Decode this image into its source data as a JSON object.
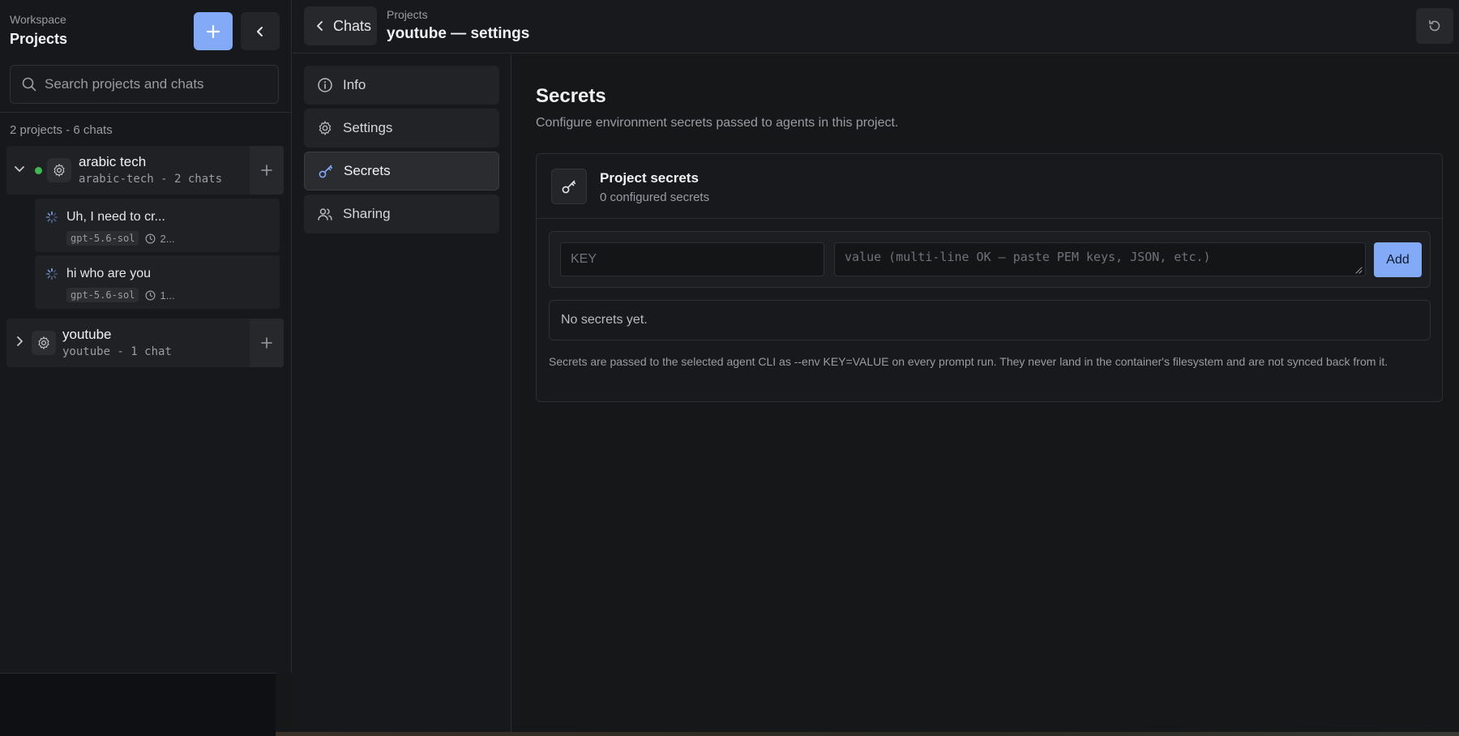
{
  "sidebar": {
    "eyebrow": "Workspace",
    "title": "Projects",
    "search_placeholder": "Search projects and chats",
    "summary": "2 projects - 6 chats",
    "projects": [
      {
        "name": "arabic tech",
        "sub": "arabic-tech - 2 chats",
        "status_color": "#3fb950",
        "chats": [
          {
            "title": "Uh, I need to cr...",
            "model": "gpt-5.6-sol",
            "time": "2..."
          },
          {
            "title": "hi who are you",
            "model": "gpt-5.6-sol",
            "time": "1..."
          }
        ]
      },
      {
        "name": "youtube",
        "sub": "youtube - 1 chat"
      }
    ]
  },
  "topbar": {
    "back_label": "Chats",
    "breadcrumb": "Projects",
    "title": "youtube — settings"
  },
  "nav": {
    "items": [
      {
        "label": "Info",
        "icon": "info-icon"
      },
      {
        "label": "Settings",
        "icon": "gear-icon"
      },
      {
        "label": "Secrets",
        "icon": "key-icon",
        "active": true
      },
      {
        "label": "Sharing",
        "icon": "users-icon"
      }
    ]
  },
  "main": {
    "heading": "Secrets",
    "description": "Configure environment secrets passed to agents in this project.",
    "card": {
      "title": "Project secrets",
      "subtitle": "0 configured secrets",
      "key_placeholder": "KEY",
      "value_placeholder": "value (multi-line OK — paste PEM keys, JSON, etc.)",
      "add_label": "Add",
      "empty_text": "No secrets yet.",
      "note": "Secrets are passed to the selected agent CLI as --env KEY=VALUE on every prompt run. They never land in the container's filesystem and are not synced back from it."
    }
  },
  "colors": {
    "accent": "#82aaf6",
    "spinner": "#82aaf6",
    "status_online": "#3fb950"
  }
}
